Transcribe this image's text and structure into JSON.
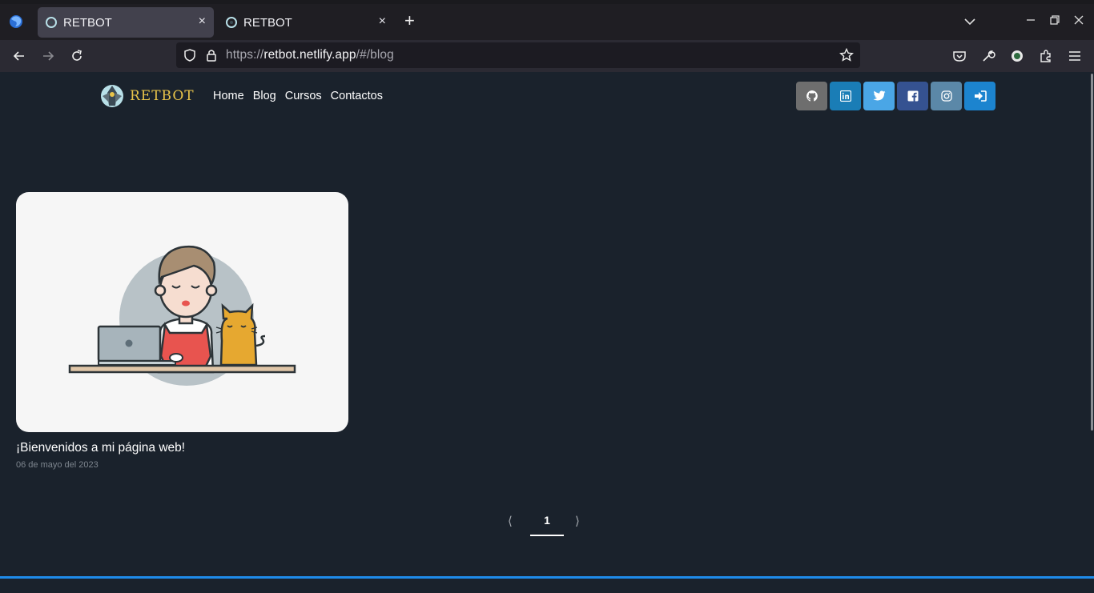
{
  "browser": {
    "tabs": [
      {
        "title": "RETBOT",
        "close": "×"
      },
      {
        "title": "RETBOT",
        "close": "×"
      }
    ],
    "new_tab_label": "+",
    "url_scheme": "https://",
    "url_host": "retbot.netlify.app",
    "url_path": "/#/blog"
  },
  "site": {
    "logo_text": "RETBOT",
    "nav": [
      "Home",
      "Blog",
      "Cursos",
      "Contactos"
    ],
    "socials": [
      {
        "icon": "github-icon",
        "color": "#6e6e6e"
      },
      {
        "icon": "linkedin-icon",
        "color": "#1a7db6"
      },
      {
        "icon": "twitter-icon",
        "color": "#4aa6e6"
      },
      {
        "icon": "facebook-icon",
        "color": "#355291"
      },
      {
        "icon": "instagram-icon",
        "color": "#5b88a8"
      },
      {
        "icon": "sign-in-icon",
        "color": "#1c84cf"
      }
    ]
  },
  "post": {
    "title": "¡Bienvenidos a mi página web!",
    "date": "06 de mayo del 2023"
  },
  "pagination": {
    "prev": "⟨",
    "current": "1",
    "next": "⟩"
  }
}
